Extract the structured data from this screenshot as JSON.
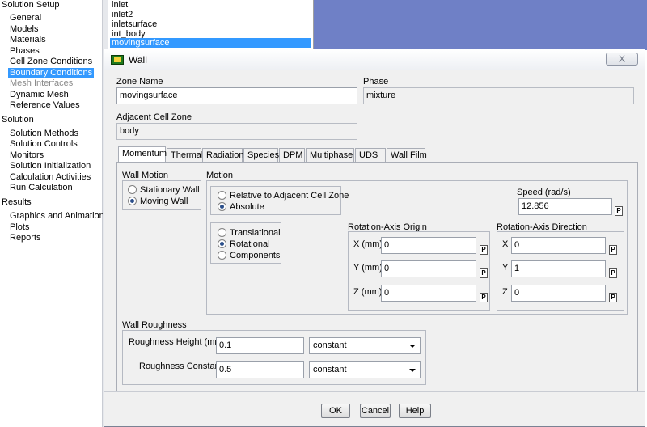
{
  "tree": {
    "sections": [
      {
        "label": "Solution Setup",
        "items": [
          "General",
          "Models",
          "Materials",
          "Phases",
          "Cell Zone Conditions",
          "Boundary Conditions",
          "Mesh Interfaces",
          "Dynamic Mesh",
          "Reference Values"
        ]
      },
      {
        "label": "Solution",
        "items": [
          "Solution Methods",
          "Solution Controls",
          "Monitors",
          "Solution Initialization",
          "Calculation Activities",
          "Run Calculation"
        ]
      },
      {
        "label": "Results",
        "items": [
          "Graphics and Animations",
          "Plots",
          "Reports"
        ]
      }
    ]
  },
  "zone_list": [
    "inlet",
    "inlet2",
    "inletsurface",
    "int_body",
    "movingsurface"
  ],
  "dialog": {
    "title": "Wall",
    "close": "X",
    "zone_name_label": "Zone Name",
    "zone_name": "movingsurface",
    "phase_label": "Phase",
    "phase": "mixture",
    "adjacent_label": "Adjacent Cell Zone",
    "adjacent": "body",
    "tabs": [
      "Momentum",
      "Thermal",
      "Radiation",
      "Species",
      "DPM",
      "Multiphase",
      "UDS",
      "Wall Film"
    ],
    "wall_motion_label": "Wall Motion",
    "stationary_wall": "Stationary Wall",
    "moving_wall": "Moving Wall",
    "motion_label": "Motion",
    "relative": "Relative to Adjacent Cell Zone",
    "absolute": "Absolute",
    "translational": "Translational",
    "rotational": "Rotational",
    "components": "Components",
    "speed_label": "Speed (rad/s)",
    "speed": "12.856",
    "p": "P",
    "origin_label": "Rotation-Axis Origin",
    "direction_label": "Rotation-Axis Direction",
    "x_mm": "X (mm)",
    "y_mm": "Y (mm)",
    "z_mm": "Z (mm)",
    "x": "X",
    "y": "Y",
    "z": "Z",
    "origin_x": "0",
    "origin_y": "0",
    "origin_z": "0",
    "dir_x": "0",
    "dir_y": "1",
    "dir_z": "0",
    "roughness_label": "Wall Roughness",
    "rough_height_label": "Roughness Height (mm)",
    "rough_height": "0.1",
    "rough_const_label": "Roughness Constant",
    "rough_const": "0.5",
    "constant": "constant",
    "ok": "OK",
    "cancel": "Cancel",
    "help": "Help"
  }
}
